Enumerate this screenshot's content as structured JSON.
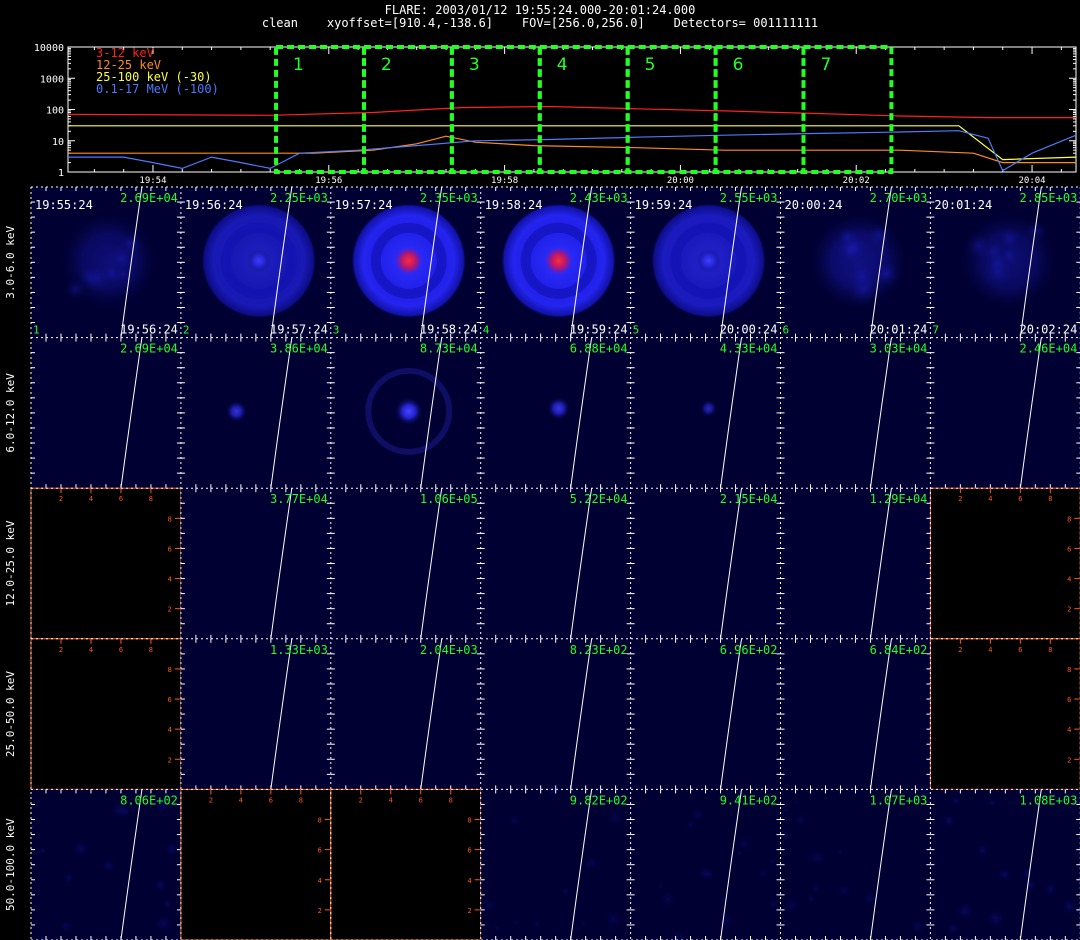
{
  "header": {
    "title": "FLARE: 2003/01/12 19:55:24.000-20:01:24.000",
    "subtitle": "clean    xyoffset=[910.4,-138.6]    FOV=[256.0,256.0]    Detectors= 001111111"
  },
  "colors": {
    "red": "#ff2020",
    "orange": "#ff8c1a",
    "yellow": "#ffff40",
    "blue": "#4a7aff",
    "green": "#22ff22",
    "axis": "#ffffff",
    "lines": "#ffffff",
    "tick": "#ff5a1a"
  },
  "chart_data": {
    "type": "line",
    "y_scale": "log",
    "ylim": [
      1,
      10000
    ],
    "yticks": [
      "1",
      "10",
      "100",
      "1000",
      "10000"
    ],
    "xticks": [
      "19:54",
      "19:56",
      "19:58",
      "20:00",
      "20:02",
      "20:04"
    ],
    "xlim": [
      "19:53:02",
      "20:04:30"
    ],
    "series": [
      {
        "name": "3-12 keV",
        "color": "#ff2020",
        "points": [
          [
            "19:53:02",
            70
          ],
          [
            "19:55:20",
            65
          ],
          [
            "19:56:30",
            80
          ],
          [
            "19:57:30",
            115
          ],
          [
            "19:58:30",
            125
          ],
          [
            "19:59:30",
            105
          ],
          [
            "20:00:30",
            90
          ],
          [
            "20:01:30",
            75
          ],
          [
            "20:02:30",
            62
          ],
          [
            "20:03:30",
            55
          ],
          [
            "20:04:30",
            55
          ]
        ]
      },
      {
        "name": "12-25 keV",
        "color": "#ff8c1a",
        "points": [
          [
            "19:53:02",
            4
          ],
          [
            "19:55:50",
            4
          ],
          [
            "19:56:30",
            5
          ],
          [
            "19:57:00",
            8
          ],
          [
            "19:57:20",
            14
          ],
          [
            "19:57:40",
            9
          ],
          [
            "19:58:20",
            7
          ],
          [
            "19:59:30",
            6
          ],
          [
            "20:00:30",
            5
          ],
          [
            "20:01:30",
            5
          ],
          [
            "20:02:30",
            5
          ],
          [
            "20:03:20",
            4
          ],
          [
            "20:03:40",
            2
          ],
          [
            "20:04:00",
            2
          ],
          [
            "20:04:30",
            2
          ]
        ]
      },
      {
        "name": "25-100 keV (-30)",
        "color": "#ffff40",
        "points": [
          [
            "19:53:02",
            30
          ],
          [
            "19:56:00",
            30
          ],
          [
            "19:57:00",
            30
          ],
          [
            "19:58:00",
            30
          ],
          [
            "20:00:00",
            30
          ],
          [
            "20:02:00",
            30
          ],
          [
            "20:03:10",
            30
          ],
          [
            "20:03:40",
            2.5
          ],
          [
            "20:04:30",
            3
          ]
        ]
      },
      {
        "name": "0.1-17 MeV (-100)",
        "color": "#4a7aff",
        "points": [
          [
            "19:53:02",
            3
          ],
          [
            "19:53:40",
            3
          ],
          [
            "19:54:00",
            2
          ],
          [
            "19:54:20",
            1.3
          ],
          [
            "19:54:40",
            3
          ],
          [
            "19:55:00",
            2
          ],
          [
            "19:55:20",
            1.3
          ],
          [
            "19:55:40",
            4
          ],
          [
            "19:56:20",
            5
          ],
          [
            "19:57:00",
            7
          ],
          [
            "19:57:40",
            10
          ],
          [
            "19:58:30",
            11
          ],
          [
            "19:59:30",
            13
          ],
          [
            "20:00:30",
            15
          ],
          [
            "20:01:30",
            17
          ],
          [
            "20:02:30",
            19
          ],
          [
            "20:03:10",
            21
          ],
          [
            "20:03:30",
            12
          ],
          [
            "20:03:40",
            1.1
          ],
          [
            "20:04:00",
            4
          ],
          [
            "20:04:30",
            15
          ]
        ]
      }
    ],
    "windows": [
      {
        "label": "1",
        "start": "19:55:24",
        "end": "19:56:24"
      },
      {
        "label": "2",
        "start": "19:56:24",
        "end": "19:57:24"
      },
      {
        "label": "3",
        "start": "19:57:24",
        "end": "19:58:24"
      },
      {
        "label": "4",
        "start": "19:58:24",
        "end": "19:59:24"
      },
      {
        "label": "5",
        "start": "19:59:24",
        "end": "20:00:24"
      },
      {
        "label": "6",
        "start": "20:00:24",
        "end": "20:01:24"
      },
      {
        "label": "7",
        "start": "20:01:24",
        "end": "20:02:24"
      }
    ]
  },
  "image_grid": {
    "row_labels": [
      "3.0-6.0 keV",
      "6.0-12.0 keV",
      "12.0-25.0 keV",
      "25.0-50.0 keV",
      "50.0-100.0 keV"
    ],
    "columns": [
      {
        "index": "1",
        "start": "19:55:24",
        "end": "19:56:24"
      },
      {
        "index": "2",
        "start": "19:56:24",
        "end": "19:57:24"
      },
      {
        "index": "3",
        "start": "19:57:24",
        "end": "19:58:24"
      },
      {
        "index": "4",
        "start": "19:58:24",
        "end": "19:59:24"
      },
      {
        "index": "5",
        "start": "19:59:24",
        "end": "20:00:24"
      },
      {
        "index": "6",
        "start": "20:00:24",
        "end": "20:01:24"
      },
      {
        "index": "7",
        "start": "20:01:24",
        "end": "20:02:24"
      }
    ],
    "maxima": [
      [
        "2.69E+04",
        "2.25E+03",
        "2.35E+03",
        "2.43E+03",
        "2.55E+03",
        "2.70E+03",
        "2.85E+03"
      ],
      [
        "2.69E+04",
        "3.86E+04",
        "8.73E+04",
        "6.88E+04",
        "4.33E+04",
        "3.03E+04",
        "2.46E+04"
      ],
      [
        "",
        "3.77E+04",
        "1.06E+05",
        "5.22E+04",
        "2.15E+04",
        "1.29E+04",
        ""
      ],
      [
        "",
        "1.33E+03",
        "2.04E+03",
        "8.23E+02",
        "6.96E+02",
        "6.84E+02",
        ""
      ],
      [
        "8.06E+02",
        "",
        "",
        "9.82E+02",
        "9.41E+02",
        "1.07E+03",
        "1.08E+03"
      ]
    ],
    "empty_axis_ticks": [
      "2",
      "4",
      "6",
      "8"
    ],
    "emission": [
      [
        {
          "kind": "diffuse",
          "level": 0.45
        },
        {
          "kind": "ring",
          "level": 0.7,
          "core": 0.3
        },
        {
          "kind": "ring",
          "level": 1.0,
          "core": 1.0
        },
        {
          "kind": "ring",
          "level": 1.0,
          "core": 1.0
        },
        {
          "kind": "ring",
          "level": 0.75,
          "core": 0.35
        },
        {
          "kind": "diffuse",
          "level": 0.55
        },
        {
          "kind": "diffuse",
          "level": 0.45
        }
      ],
      [
        {
          "kind": "none",
          "level": 0
        },
        {
          "kind": "source",
          "level": 0.45
        },
        {
          "kind": "source",
          "level": 0.9
        },
        {
          "kind": "source",
          "level": 0.55
        },
        {
          "kind": "source",
          "level": 0.15
        },
        {
          "kind": "none",
          "level": 0
        },
        {
          "kind": "none",
          "level": 0
        }
      ],
      [
        {
          "kind": "empty"
        },
        {
          "kind": "none",
          "level": 0
        },
        {
          "kind": "none",
          "level": 0
        },
        {
          "kind": "none",
          "level": 0
        },
        {
          "kind": "none",
          "level": 0
        },
        {
          "kind": "none",
          "level": 0
        },
        {
          "kind": "empty"
        }
      ],
      [
        {
          "kind": "empty"
        },
        {
          "kind": "none",
          "level": 0
        },
        {
          "kind": "none",
          "level": 0
        },
        {
          "kind": "none",
          "level": 0
        },
        {
          "kind": "none",
          "level": 0
        },
        {
          "kind": "none",
          "level": 0
        },
        {
          "kind": "empty"
        }
      ],
      [
        {
          "kind": "speckle",
          "level": 0.3
        },
        {
          "kind": "empty"
        },
        {
          "kind": "empty"
        },
        {
          "kind": "speckle",
          "level": 0.2
        },
        {
          "kind": "speckle",
          "level": 0.2
        },
        {
          "kind": "speckle",
          "level": 0.2
        },
        {
          "kind": "speckle",
          "level": 0.3
        }
      ]
    ]
  }
}
